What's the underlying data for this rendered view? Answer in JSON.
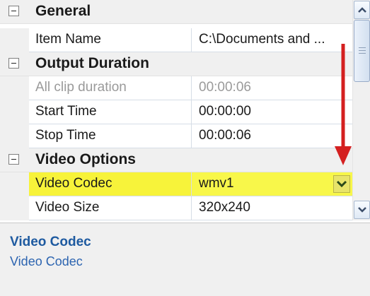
{
  "categories": {
    "general": "General",
    "output_duration": "Output Duration",
    "video_options": "Video Options"
  },
  "properties": {
    "item_name": {
      "name": "Item Name",
      "value": "C:\\Documents and ..."
    },
    "all_clip_duration": {
      "name": "All clip duration",
      "value": "00:00:06"
    },
    "start_time": {
      "name": "Start Time",
      "value": "00:00:00"
    },
    "stop_time": {
      "name": "Stop Time",
      "value": "00:00:06"
    },
    "video_codec": {
      "name": "Video Codec",
      "value": "wmv1"
    },
    "video_size": {
      "name": "Video Size",
      "value": "320x240"
    }
  },
  "description": {
    "title": "Video Codec",
    "text": "Video Codec"
  },
  "colors": {
    "highlight": "#f7f33a",
    "description_title": "#1e5aa0",
    "annotation_arrow": "#d42020"
  },
  "icons": {
    "expander": "collapse-minus-icon",
    "dropdown": "chevron-down-icon",
    "scroll_up": "chevron-up-icon",
    "scroll_down": "chevron-down-icon"
  }
}
